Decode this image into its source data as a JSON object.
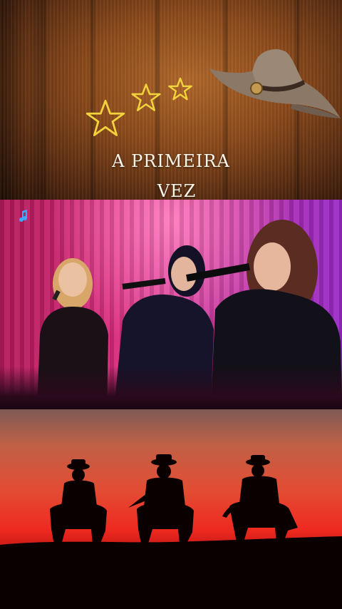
{
  "title_line1": "A PRIMEIRA",
  "title_line2": "VEZ",
  "colors": {
    "star_outline": "#f2d33c",
    "title_text": "#fff6ea"
  },
  "icons": [
    "star-icon",
    "cowboy-hat-icon",
    "music-note-icon"
  ]
}
